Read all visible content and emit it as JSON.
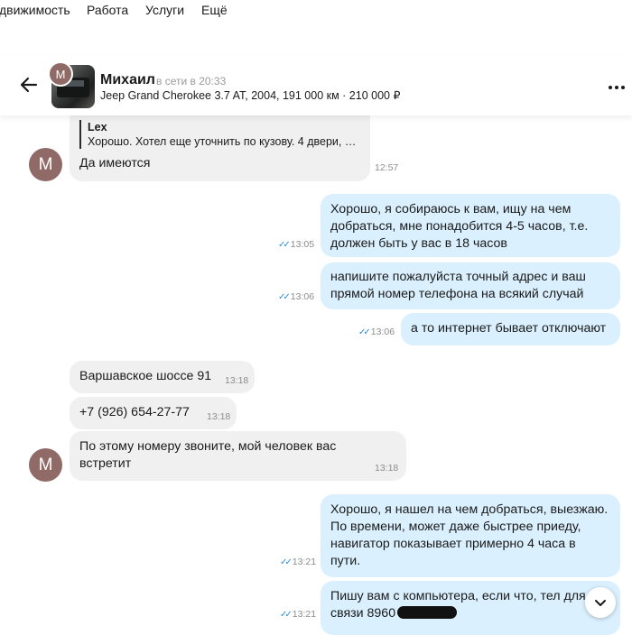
{
  "topnav": {
    "items": [
      "движимость",
      "Работа",
      "Услуги",
      "Ещё"
    ]
  },
  "header": {
    "avatar_letter": "М",
    "name": "Михаил",
    "status": "в сети в 20:33",
    "ad_info": "Jeep Grand Cherokee 3.7 AT, 2004, 191 000 км · 210 000 ₽"
  },
  "messages": {
    "m1": {
      "quote_author": "Lex",
      "quote_text": "Хорошо. Хотел еще уточнить по кузову. 4 двери, б...",
      "text": "Да имеются",
      "time": "12:57",
      "avatar": "М"
    },
    "m2": {
      "lines": [
        "Хорошо, я собираюсь к вам, ищу на чем",
        "добраться, мне понадобится 4-5 часов, т.е.",
        "должен быть у вас в 18 часов"
      ],
      "time": "13:05"
    },
    "m3": {
      "lines": [
        "напишите пожалуйста точный адрес и ваш",
        "прямой номер телефона на всякий случай"
      ],
      "time": "13:06"
    },
    "m4": {
      "text": "а то интернет бывает отключают",
      "time": "13:06"
    },
    "m5": {
      "text": "Варшавское шоссе 91",
      "time": "13:18"
    },
    "m6": {
      "text": "+7 (926) 654-27-77",
      "time": "13:18"
    },
    "m7": {
      "lines": [
        "По этому номеру звоните, мой человек вас",
        "встретит"
      ],
      "time": "13:18",
      "avatar": "М"
    },
    "m8": {
      "lines": [
        "Хорошо, я нашел на чем добраться, выезжаю.",
        "По времени, может даже быстрее приеду,",
        "навигатор показывает примерно 4 часа в",
        "пути."
      ],
      "time": "13:21"
    },
    "m9": {
      "lines": [
        "Пишу вам с компьютера, если что, тел для",
        "связи 8960"
      ],
      "time": "13:21"
    }
  },
  "icons": {
    "back": "arrow-left-icon",
    "more": "more-dots-icon",
    "read": "double-check-icon",
    "scroll": "chevron-down-icon"
  },
  "colors": {
    "incoming": "#f0f0f0",
    "outgoing": "#daf0fe",
    "check": "#2c8bde",
    "avatar": "#8f6a66"
  }
}
